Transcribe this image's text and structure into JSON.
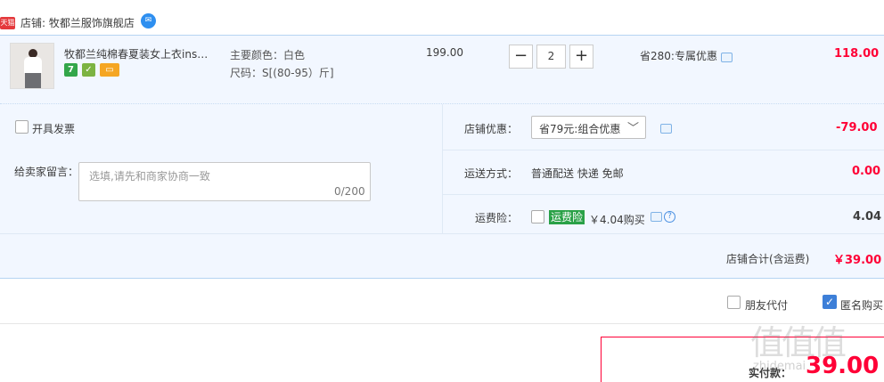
{
  "shop": {
    "badge": "天猫",
    "name": "店铺: 牧都兰服饰旗舰店",
    "chat_icon": "chat-icon"
  },
  "item": {
    "title": "牧都兰纯棉春夏装女上衣ins潮...",
    "sku_color": "主要颜色：白色",
    "sku_size": "尺码：S[(80-95）斤]",
    "badges": [
      "7",
      "ⓘ",
      "card"
    ],
    "unit_price": "199.00",
    "quantity": "2",
    "qty_minus": "−",
    "qty_plus": "+",
    "saving": "省280:专属优惠",
    "total": "118.00"
  },
  "options": {
    "invoice_label": "开具发票",
    "message_label": "给卖家留言：",
    "message_placeholder": "选填,请先和商家协商一致",
    "message_count": "0/200",
    "discount_label": "店铺优惠：",
    "discount_selected": "省79元:组合优惠",
    "discount_value": "-79.00",
    "shipping_label": "运送方式：",
    "shipping_value": "普通配送 快递 免邮",
    "shipping_cost": "0.00",
    "insurance_label": "运费险：",
    "insurance_tag": "运费险",
    "insurance_text": "￥4.04购买",
    "insurance_value": "4.04",
    "subtotal_label": "店铺合计(含运费)",
    "subtotal_value": "￥39.00"
  },
  "footer": {
    "friend_pay_label": "朋友代付",
    "anonymous_label": "匿名购买",
    "anonymous_checked": true,
    "pay_label": "实付款：",
    "pay_amount": "39.00",
    "watermark": "值值值",
    "watermark_small": "zhidemai"
  },
  "colors": {
    "accent_red": "#ff0036",
    "row_bg": "#f2f7ff",
    "border_blue": "#b6d4f2",
    "check_blue": "#3d7fd8",
    "insurance_green": "#2aa147"
  }
}
